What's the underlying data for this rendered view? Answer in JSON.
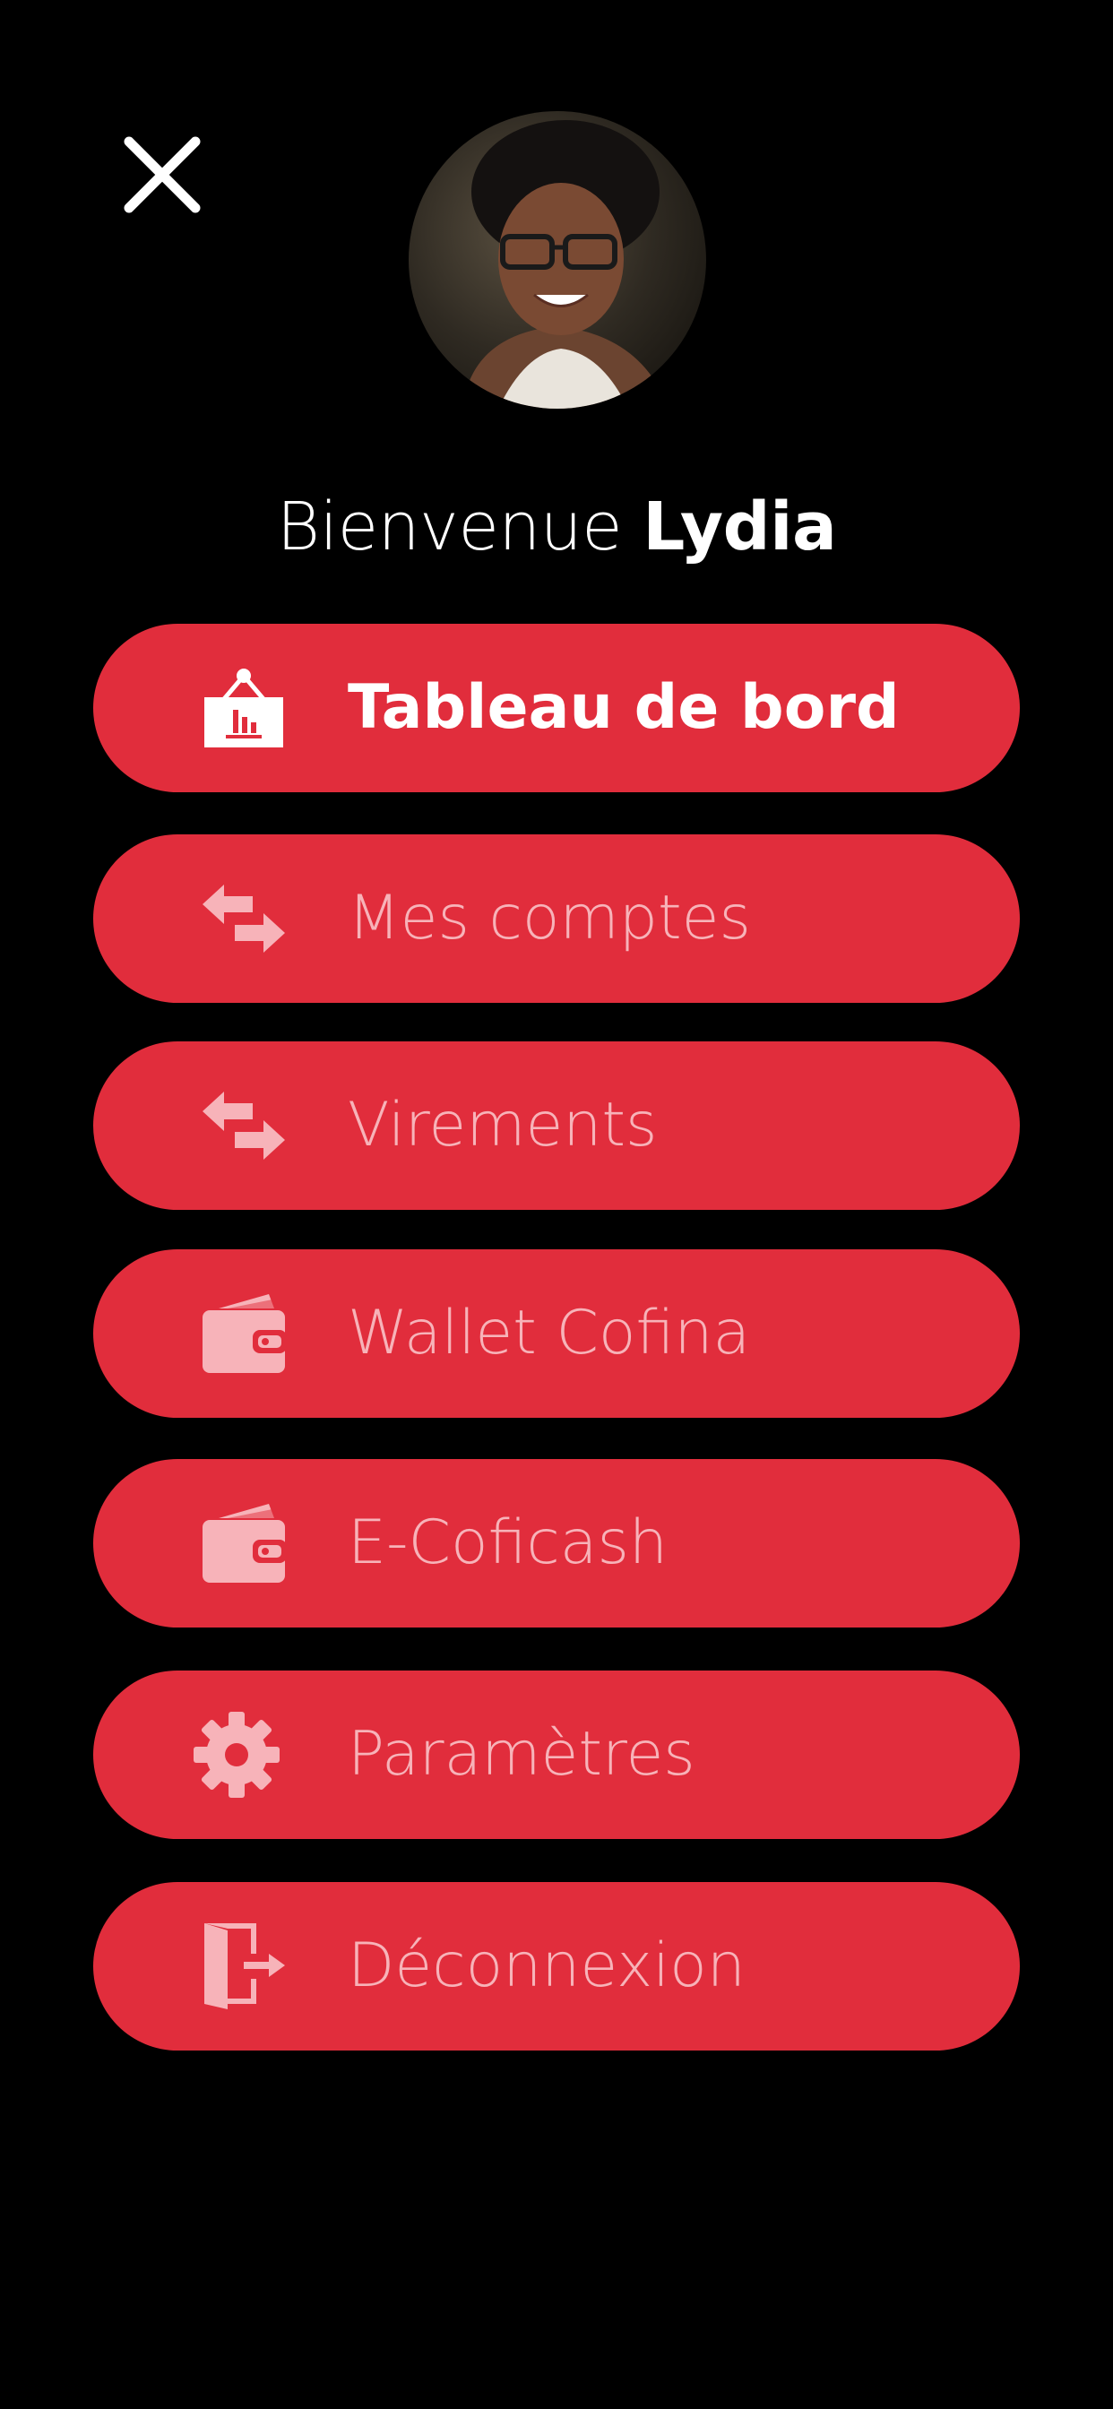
{
  "header": {
    "close_icon": "close-icon",
    "avatar_alt": "Lydia"
  },
  "welcome": {
    "greeting": "Bienvenue",
    "name": "Lydia"
  },
  "menu": {
    "items": [
      {
        "label": "Tableau de bord",
        "icon": "dashboard-icon",
        "active": true
      },
      {
        "label": "Mes comptes",
        "icon": "transfer-arrows-icon",
        "active": false
      },
      {
        "label": "Virements",
        "icon": "transfer-arrows-icon",
        "active": false
      },
      {
        "label": "Wallet Cofina",
        "icon": "wallet-icon",
        "active": false
      },
      {
        "label": "E-Coficash",
        "icon": "wallet-icon",
        "active": false
      },
      {
        "label": "Paramètres",
        "icon": "gear-icon",
        "active": false
      },
      {
        "label": "Déconnexion",
        "icon": "logout-door-icon",
        "active": false
      }
    ]
  },
  "colors": {
    "background": "#000000",
    "button": "#e12d3c",
    "active_text": "#ffffff",
    "inactive_text": "#f7b3b9"
  }
}
